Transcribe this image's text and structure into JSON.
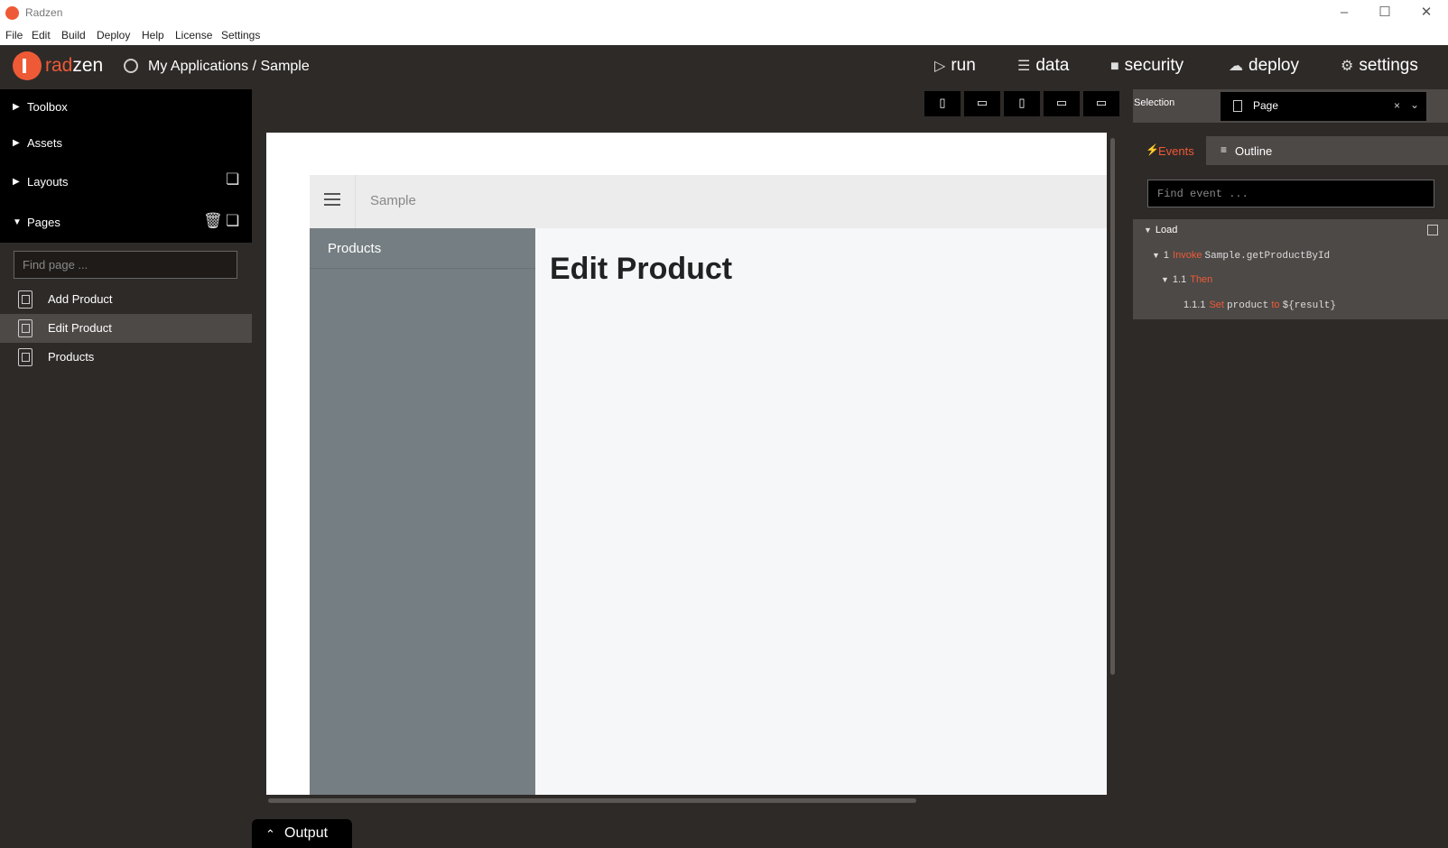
{
  "window": {
    "title": "Radzen"
  },
  "menu": [
    "File",
    "Edit",
    "Build",
    "Deploy",
    "Help",
    "License",
    "Settings"
  ],
  "header": {
    "brand_prefix": "rad",
    "brand_suffix": "zen",
    "breadcrumb": "My Applications / Sample",
    "nav": [
      {
        "label": "run",
        "icon": "play-icon"
      },
      {
        "label": "data",
        "icon": "layers-icon"
      },
      {
        "label": "security",
        "icon": "lock-icon"
      },
      {
        "label": "deploy",
        "icon": "cloud-upload-icon"
      },
      {
        "label": "settings",
        "icon": "gear-icon"
      }
    ]
  },
  "left_panel": {
    "sections": [
      "Toolbox",
      "Assets",
      "Layouts",
      "Pages"
    ],
    "find_page_placeholder": "Find page ...",
    "pages": [
      "Add Product",
      "Edit Product",
      "Products"
    ],
    "selected_page": "Edit Product"
  },
  "canvas": {
    "app_name": "Sample",
    "sidebar_item": "Products",
    "page_heading": "Edit Product"
  },
  "output": {
    "label": "Output"
  },
  "right_panel": {
    "selection_label": "Selection",
    "selection_value": "Page",
    "tabs": {
      "events": "Events",
      "outline": "Outline"
    },
    "find_event_placeholder": "Find event ...",
    "events": {
      "load": "Load",
      "invoke": {
        "num": "1",
        "keyword": "Invoke",
        "target": "Sample.getProductById"
      },
      "then": {
        "num": "1.1",
        "keyword": "Then"
      },
      "set": {
        "num": "1.1.1",
        "keyword": "Set",
        "name": "product",
        "to": "to",
        "value": "${result}"
      }
    }
  },
  "colors": {
    "accent": "#ee5a36",
    "background": "#2e2a28"
  }
}
